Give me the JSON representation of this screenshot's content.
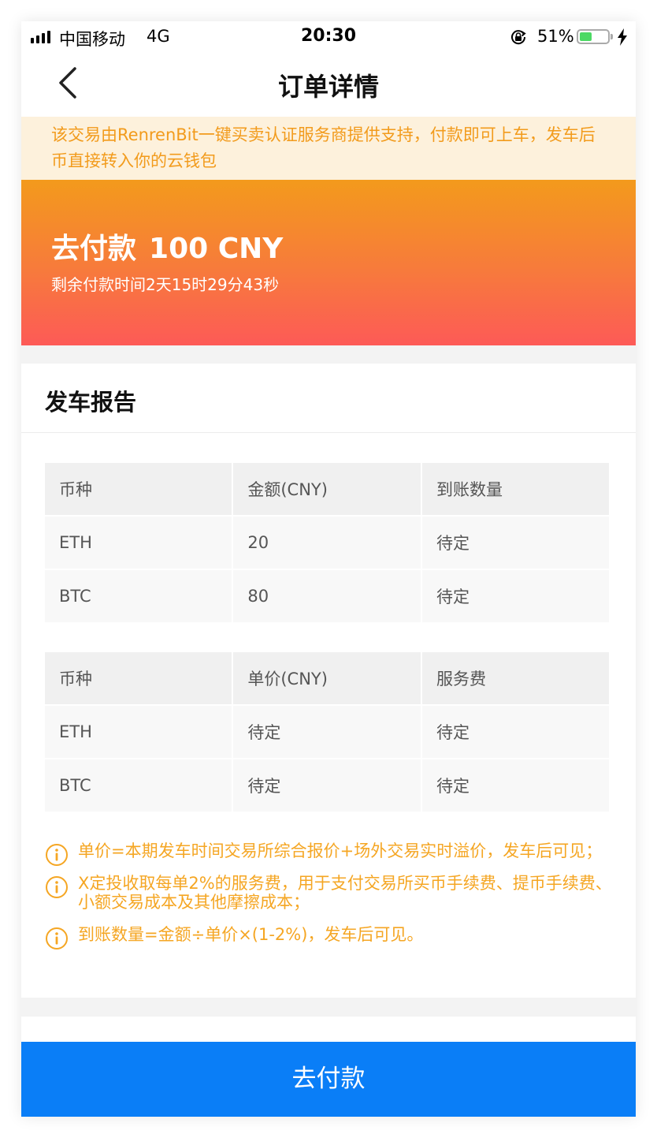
{
  "status_bar": {
    "carrier": "中国移动",
    "network": "4G",
    "time": "20:30",
    "battery_percent_label": "51%",
    "battery_level": 0.51
  },
  "nav": {
    "title": "订单详情",
    "back_icon": "chevron-left-icon"
  },
  "notice": {
    "text": "该交易由RenrenBit一键买卖认证服务商提供支持，付款即可上车，发车后币直接转入你的云钱包"
  },
  "payment": {
    "label": "去付款",
    "amount": "100 CNY",
    "countdown": "剩余付款时间2天15时29分43秒",
    "gradient_colors": [
      "#f39a1c",
      "#fd5a57"
    ]
  },
  "report": {
    "title": "发车报告",
    "table1": {
      "headers": [
        "币种",
        "金额(CNY)",
        "到账数量"
      ],
      "rows": [
        [
          "ETH",
          "20",
          "待定"
        ],
        [
          "BTC",
          "80",
          "待定"
        ]
      ]
    },
    "table2": {
      "headers": [
        "币种",
        "单价(CNY)",
        "服务费"
      ],
      "rows": [
        [
          "ETH",
          "待定",
          "待定"
        ],
        [
          "BTC",
          "待定",
          "待定"
        ]
      ]
    },
    "notes": [
      "单价=本期发车时间交易所综合报价+场外交易实时溢价，发车后可见；",
      "X定投收取每单2%的服务费，用于支付交易所买币手续费、提币手续费、小额交易成本及其他摩擦成本；",
      "到账数量=金额÷单价×(1-2%)，发车后可见。"
    ],
    "note_color": "#f5a623",
    "note_icon": "info-circle-icon"
  },
  "footer": {
    "pay_button": "去付款",
    "button_color": "#0a7ef7"
  }
}
